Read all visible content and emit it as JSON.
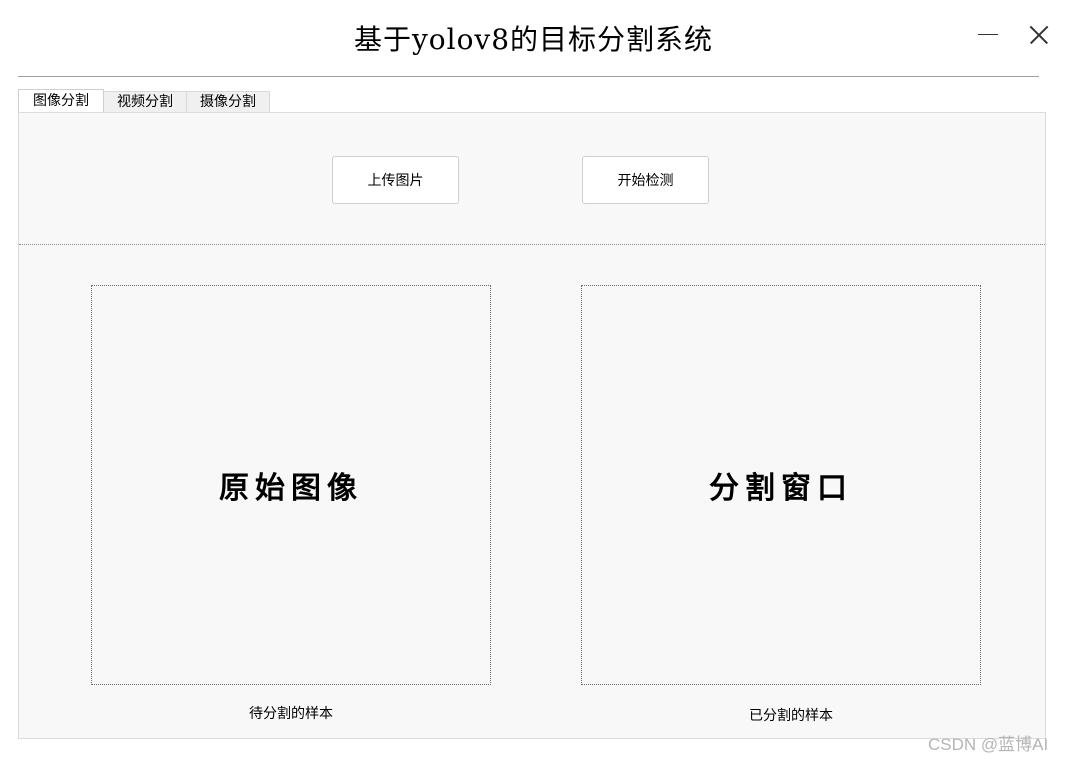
{
  "window": {
    "title": "基于yolov8的目标分割系统"
  },
  "tabs": [
    {
      "label": "图像分割",
      "active": true
    },
    {
      "label": "视频分割",
      "active": false
    },
    {
      "label": "摄像分割",
      "active": false
    }
  ],
  "toolbar": {
    "upload_label": "上传图片",
    "detect_label": "开始检测"
  },
  "original_panel": {
    "placeholder": "原始图像",
    "caption": "待分割的样本"
  },
  "result_panel": {
    "placeholder": "分割窗口",
    "caption": "已分割的样本"
  },
  "watermark": "CSDN @蓝博AI",
  "icons": {
    "minimize": "minimize-icon",
    "close": "close-icon"
  },
  "colors": {
    "panel_bg": "#f8f8f8",
    "border": "#dcdcdc"
  }
}
